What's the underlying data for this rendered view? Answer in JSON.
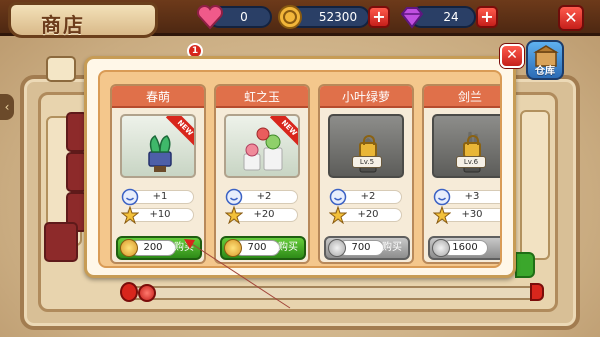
{
  "title": "商店",
  "resources": {
    "hearts": "0",
    "coins": "52300",
    "gems": "24"
  },
  "notification_count": "1",
  "storage_label": "仓库",
  "items": [
    {
      "name": "春萌",
      "is_new": true,
      "locked": false,
      "level": "",
      "stat1": "+1",
      "stat2": "+10",
      "price": "200",
      "buy_label": "购买",
      "badge": "NEW"
    },
    {
      "name": "虹之玉",
      "is_new": true,
      "locked": false,
      "level": "",
      "stat1": "+2",
      "stat2": "+20",
      "price": "700",
      "buy_label": "购买",
      "badge": "NEW"
    },
    {
      "name": "小叶绿萝",
      "is_new": false,
      "locked": true,
      "level": "Lv.5",
      "stat1": "+2",
      "stat2": "+20",
      "price": "700",
      "buy_label": "购买",
      "badge": ""
    },
    {
      "name": "剑兰",
      "is_new": false,
      "locked": true,
      "level": "Lv.6",
      "stat1": "+3",
      "stat2": "+30",
      "price": "1600",
      "buy_label": "",
      "badge": ""
    }
  ],
  "icons": {
    "heart": "heart-icon",
    "coin": "coin-icon",
    "gem": "gem-icon",
    "close": "close-icon",
    "plus": "plus-icon",
    "storage": "storage-box-icon",
    "lock": "lock-icon",
    "pot": "plant-pot-icon"
  },
  "colors": {
    "card_header": "#e0704a",
    "buy_enabled": "#2e8b18",
    "buy_disabled": "#8d8d8d",
    "close_red": "#c51f1a",
    "topbar": "#4e2812"
  }
}
